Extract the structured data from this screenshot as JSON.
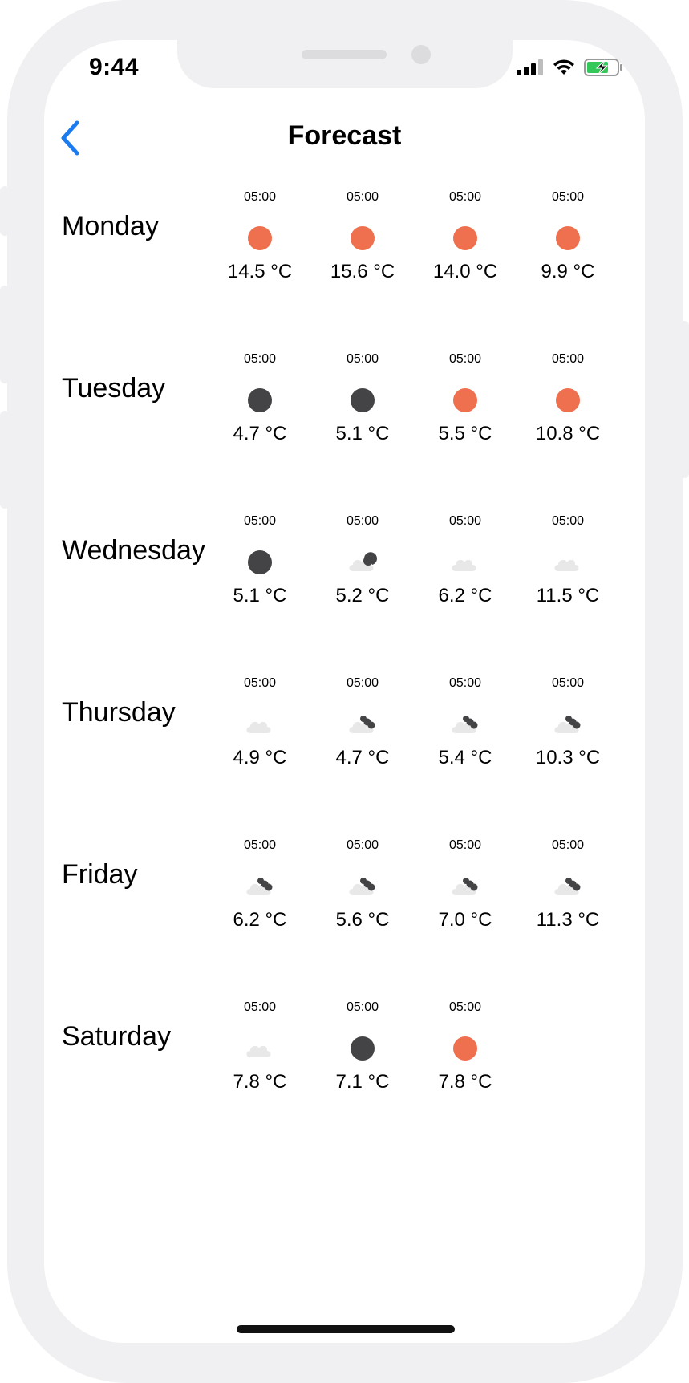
{
  "status_bar": {
    "time": "9:44"
  },
  "header": {
    "title": "Forecast",
    "back_icon": "chevron-left-icon"
  },
  "colors": {
    "accent": "#1a7cf0",
    "sun": "#ef704f",
    "moon": "#444447",
    "cloud": "#e8e8e8",
    "frame": "#f0f0f2"
  },
  "days": [
    {
      "name": "Monday",
      "slots": [
        {
          "time": "05:00",
          "icon": "sun-icon",
          "temp": "14.5 °C"
        },
        {
          "time": "05:00",
          "icon": "sun-icon",
          "temp": "15.6 °C"
        },
        {
          "time": "05:00",
          "icon": "sun-icon",
          "temp": "14.0 °C"
        },
        {
          "time": "05:00",
          "icon": "sun-icon",
          "temp": "9.9 °C"
        }
      ]
    },
    {
      "name": "Tuesday",
      "slots": [
        {
          "time": "05:00",
          "icon": "moon-icon",
          "temp": "4.7 °C"
        },
        {
          "time": "05:00",
          "icon": "moon-icon",
          "temp": "5.1 °C"
        },
        {
          "time": "05:00",
          "icon": "sun-icon",
          "temp": "5.5 °C"
        },
        {
          "time": "05:00",
          "icon": "sun-icon",
          "temp": "10.8 °C"
        }
      ]
    },
    {
      "name": "Wednesday",
      "slots": [
        {
          "time": "05:00",
          "icon": "moon-icon",
          "temp": "5.1 °C"
        },
        {
          "time": "05:00",
          "icon": "partly-cloudy-night-icon",
          "temp": "5.2 °C"
        },
        {
          "time": "05:00",
          "icon": "cloud-icon",
          "temp": "6.2 °C"
        },
        {
          "time": "05:00",
          "icon": "cloud-icon",
          "temp": "11.5 °C"
        }
      ]
    },
    {
      "name": "Thursday",
      "slots": [
        {
          "time": "05:00",
          "icon": "cloud-icon",
          "temp": "4.9 °C"
        },
        {
          "time": "05:00",
          "icon": "cloudy-icon",
          "temp": "4.7 °C"
        },
        {
          "time": "05:00",
          "icon": "cloudy-icon",
          "temp": "5.4 °C"
        },
        {
          "time": "05:00",
          "icon": "cloudy-icon",
          "temp": "10.3 °C"
        }
      ]
    },
    {
      "name": "Friday",
      "slots": [
        {
          "time": "05:00",
          "icon": "cloudy-icon",
          "temp": "6.2 °C"
        },
        {
          "time": "05:00",
          "icon": "cloudy-icon",
          "temp": "5.6 °C"
        },
        {
          "time": "05:00",
          "icon": "cloudy-icon",
          "temp": "7.0 °C"
        },
        {
          "time": "05:00",
          "icon": "cloudy-icon",
          "temp": "11.3 °C"
        }
      ]
    },
    {
      "name": "Saturday",
      "slots": [
        {
          "time": "05:00",
          "icon": "cloud-icon",
          "temp": "7.8 °C"
        },
        {
          "time": "05:00",
          "icon": "moon-icon",
          "temp": "7.1 °C"
        },
        {
          "time": "05:00",
          "icon": "sun-icon",
          "temp": "7.8 °C"
        }
      ]
    }
  ]
}
